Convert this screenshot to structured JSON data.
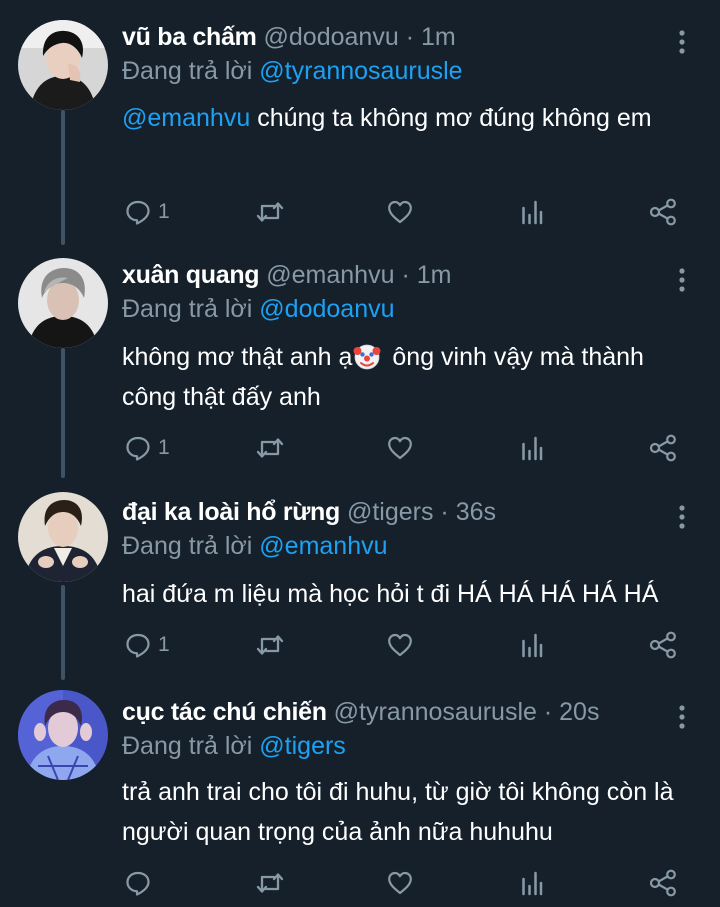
{
  "tweets": [
    {
      "name": "vũ ba chấm",
      "handle": "@dodoanvu",
      "separator": "·",
      "time": "1m",
      "reply_prefix": "Đang trả lời",
      "reply_to": "@tyrannosaurusle",
      "mention": "@emanhvu",
      "text": "chúng ta không mơ đúng không em",
      "reply_count": "1"
    },
    {
      "name": "xuân quang",
      "handle": "@emanhvu",
      "separator": "·",
      "time": "1m",
      "reply_prefix": "Đang trả lời",
      "reply_to": "@dodoanvu",
      "text_before": "không mơ thật anh ạ",
      "text_after": " ông vinh vậy mà thành công thật đấy anh",
      "reply_count": "1"
    },
    {
      "name": "đại ka loài hổ rừng",
      "handle": "@tigers",
      "separator": "·",
      "time": "36s",
      "reply_prefix": "Đang trả lời",
      "reply_to": "@emanhvu",
      "text": "hai đứa m liệu mà học hỏi t đi HÁ HÁ HÁ HÁ HÁ",
      "reply_count": "1"
    },
    {
      "name": "cục tác chú chiến",
      "handle": "@tyrannosaurusle",
      "separator": "·",
      "time": "20s",
      "reply_prefix": "Đang trả lời",
      "reply_to": "@tigers",
      "text": "trả anh trai cho tôi đi huhu, từ giờ tôi không còn là người quan trọng của ảnh nữa huhuhu",
      "reply_count": ""
    }
  ],
  "icons": {
    "reply": "reply-icon",
    "retweet": "retweet-icon",
    "like": "heart-icon",
    "analytics": "analytics-icon",
    "share": "share-icon",
    "more": "more-vertical-icon",
    "emoji": "clown-face-emoji"
  },
  "colors": {
    "background": "#15202b",
    "text": "#ffffff",
    "secondary": "#8899a6",
    "accent": "#1da1f2",
    "thread_line": "#3d5466"
  }
}
